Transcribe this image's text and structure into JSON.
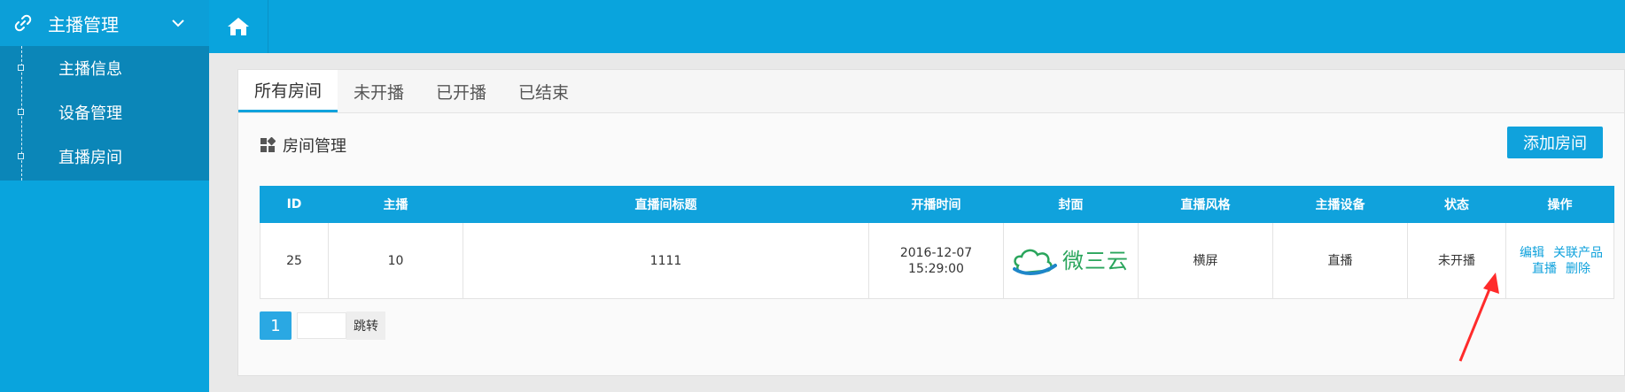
{
  "sidebar": {
    "menu_title": "主播管理",
    "items": [
      {
        "label": "主播信息"
      },
      {
        "label": "设备管理"
      },
      {
        "label": "直播房间"
      }
    ]
  },
  "tabs": [
    {
      "label": "所有房间",
      "active": true
    },
    {
      "label": "未开播",
      "active": false
    },
    {
      "label": "已开播",
      "active": false
    },
    {
      "label": "已结束",
      "active": false
    }
  ],
  "section": {
    "title": "房间管理",
    "add_button_label": "添加房间"
  },
  "table": {
    "headers": [
      "ID",
      "主播",
      "直播间标题",
      "开播时间",
      "封面",
      "直播风格",
      "主播设备",
      "状态",
      "操作"
    ],
    "rows": [
      {
        "id": "25",
        "anchor": "10",
        "title": "1111",
        "start_date": "2016-12-07",
        "start_time": "15:29:00",
        "cover_brand": "微三云",
        "style": "横屏",
        "device": "直播",
        "status": "未开播",
        "actions": {
          "edit": "编辑",
          "link_product": "关联产品",
          "live": "直播",
          "delete": "删除"
        }
      }
    ]
  },
  "pagination": {
    "current_page": "1",
    "input_value": "",
    "jump_label": "跳转"
  },
  "colors": {
    "primary": "#09a4dd",
    "submenu_bg": "#0b86b8",
    "accent": "#10a2dc",
    "annotation_arrow": "#ff2b2b"
  }
}
